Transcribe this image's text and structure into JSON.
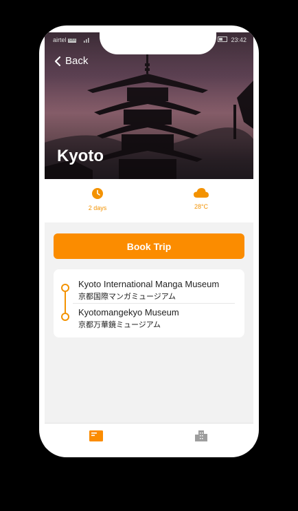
{
  "status_bar": {
    "carrier": "airtel",
    "sim_badge": "SIM",
    "battery_text": "0%",
    "time": "23:42"
  },
  "header": {
    "back_label": "Back",
    "city": "Kyoto"
  },
  "stats": {
    "duration": {
      "icon": "clock-icon",
      "label": "2 days"
    },
    "weather": {
      "icon": "cloud-icon",
      "label": "28°C"
    }
  },
  "actions": {
    "book_label": "Book Trip"
  },
  "itinerary": [
    {
      "name_en": "Kyoto International Manga Museum",
      "name_jp": "京都国際マンガミュージアム"
    },
    {
      "name_en": "Kyotomangekyo Museum",
      "name_jp": "京都万華鏡ミュージアム"
    }
  ],
  "nav": [
    {
      "icon": "book-icon",
      "active": true
    },
    {
      "icon": "city-icon",
      "active": false
    }
  ],
  "colors": {
    "accent": "#fb8c00",
    "accent_text": "#f39200",
    "inactive_icon": "#9e9e9e",
    "screen_bg": "#f2f2f2"
  }
}
